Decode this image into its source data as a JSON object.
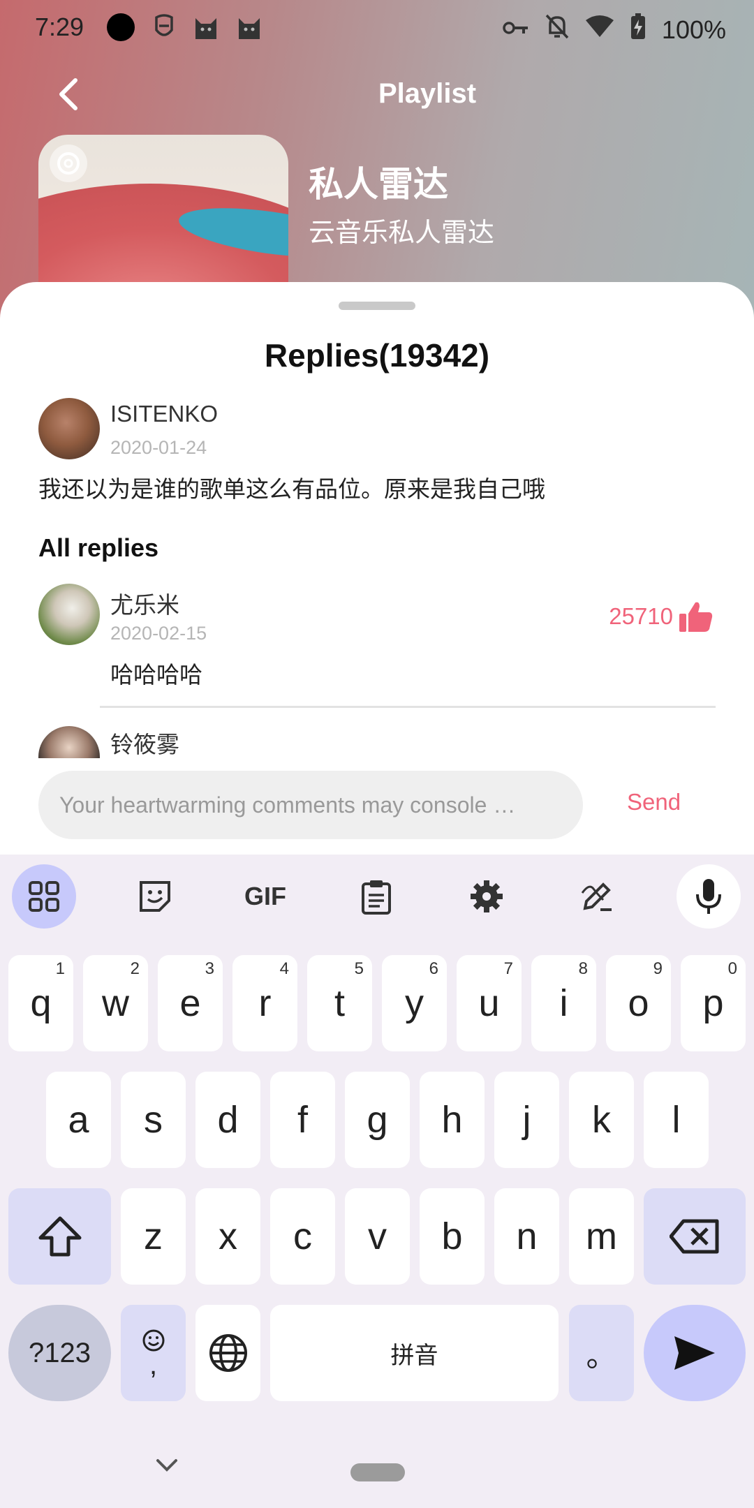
{
  "status_bar": {
    "time": "7:29",
    "battery": "100%",
    "icons_left": [
      "camera-cutout-icon",
      "face-app-icon",
      "cat-icon",
      "cat-icon"
    ],
    "icons_right": [
      "key-icon",
      "bell-off-icon",
      "wifi-icon",
      "battery-charging-icon"
    ]
  },
  "header": {
    "title": "Playlist",
    "back_icon": "chevron-left-icon"
  },
  "playlist": {
    "name": "私人雷达",
    "subtitle": "云音乐私人雷达"
  },
  "replies": {
    "title": "Replies(19342)",
    "original_comment": {
      "user": "ISITENKO",
      "date": "2020-01-24",
      "text": "我还以为是谁的歌单这么有品位。原来是我自己哦"
    },
    "section_label": "All replies",
    "items": [
      {
        "user": "尤乐米",
        "date": "2020-02-15",
        "text": "哈哈哈哈",
        "likes": "25710"
      },
      {
        "user": "铃筱雾"
      }
    ]
  },
  "comment_box": {
    "placeholder": "Your heartwarming comments may console …",
    "send_label": "Send"
  },
  "keyboard": {
    "toolbar": [
      "apps-grid-icon",
      "sticker-icon",
      "GIF",
      "clipboard-icon",
      "settings-icon",
      "handwriting-icon",
      "mic-icon"
    ],
    "row1": [
      {
        "key": "q",
        "hint": "1"
      },
      {
        "key": "w",
        "hint": "2"
      },
      {
        "key": "e",
        "hint": "3"
      },
      {
        "key": "r",
        "hint": "4"
      },
      {
        "key": "t",
        "hint": "5"
      },
      {
        "key": "y",
        "hint": "6"
      },
      {
        "key": "u",
        "hint": "7"
      },
      {
        "key": "i",
        "hint": "8"
      },
      {
        "key": "o",
        "hint": "9"
      },
      {
        "key": "p",
        "hint": "0"
      }
    ],
    "row2": [
      "a",
      "s",
      "d",
      "f",
      "g",
      "h",
      "j",
      "k",
      "l"
    ],
    "row3": [
      "z",
      "x",
      "c",
      "v",
      "b",
      "n",
      "m"
    ],
    "symbols_label": "?123",
    "comma_label": ",",
    "space_label": "拼音",
    "period_label": "。"
  },
  "colors": {
    "accent": "#f0637a",
    "keyboard_bg": "#f2edf5",
    "mod_key": "#dcdcf6",
    "enter_key": "#c7c9fb"
  }
}
